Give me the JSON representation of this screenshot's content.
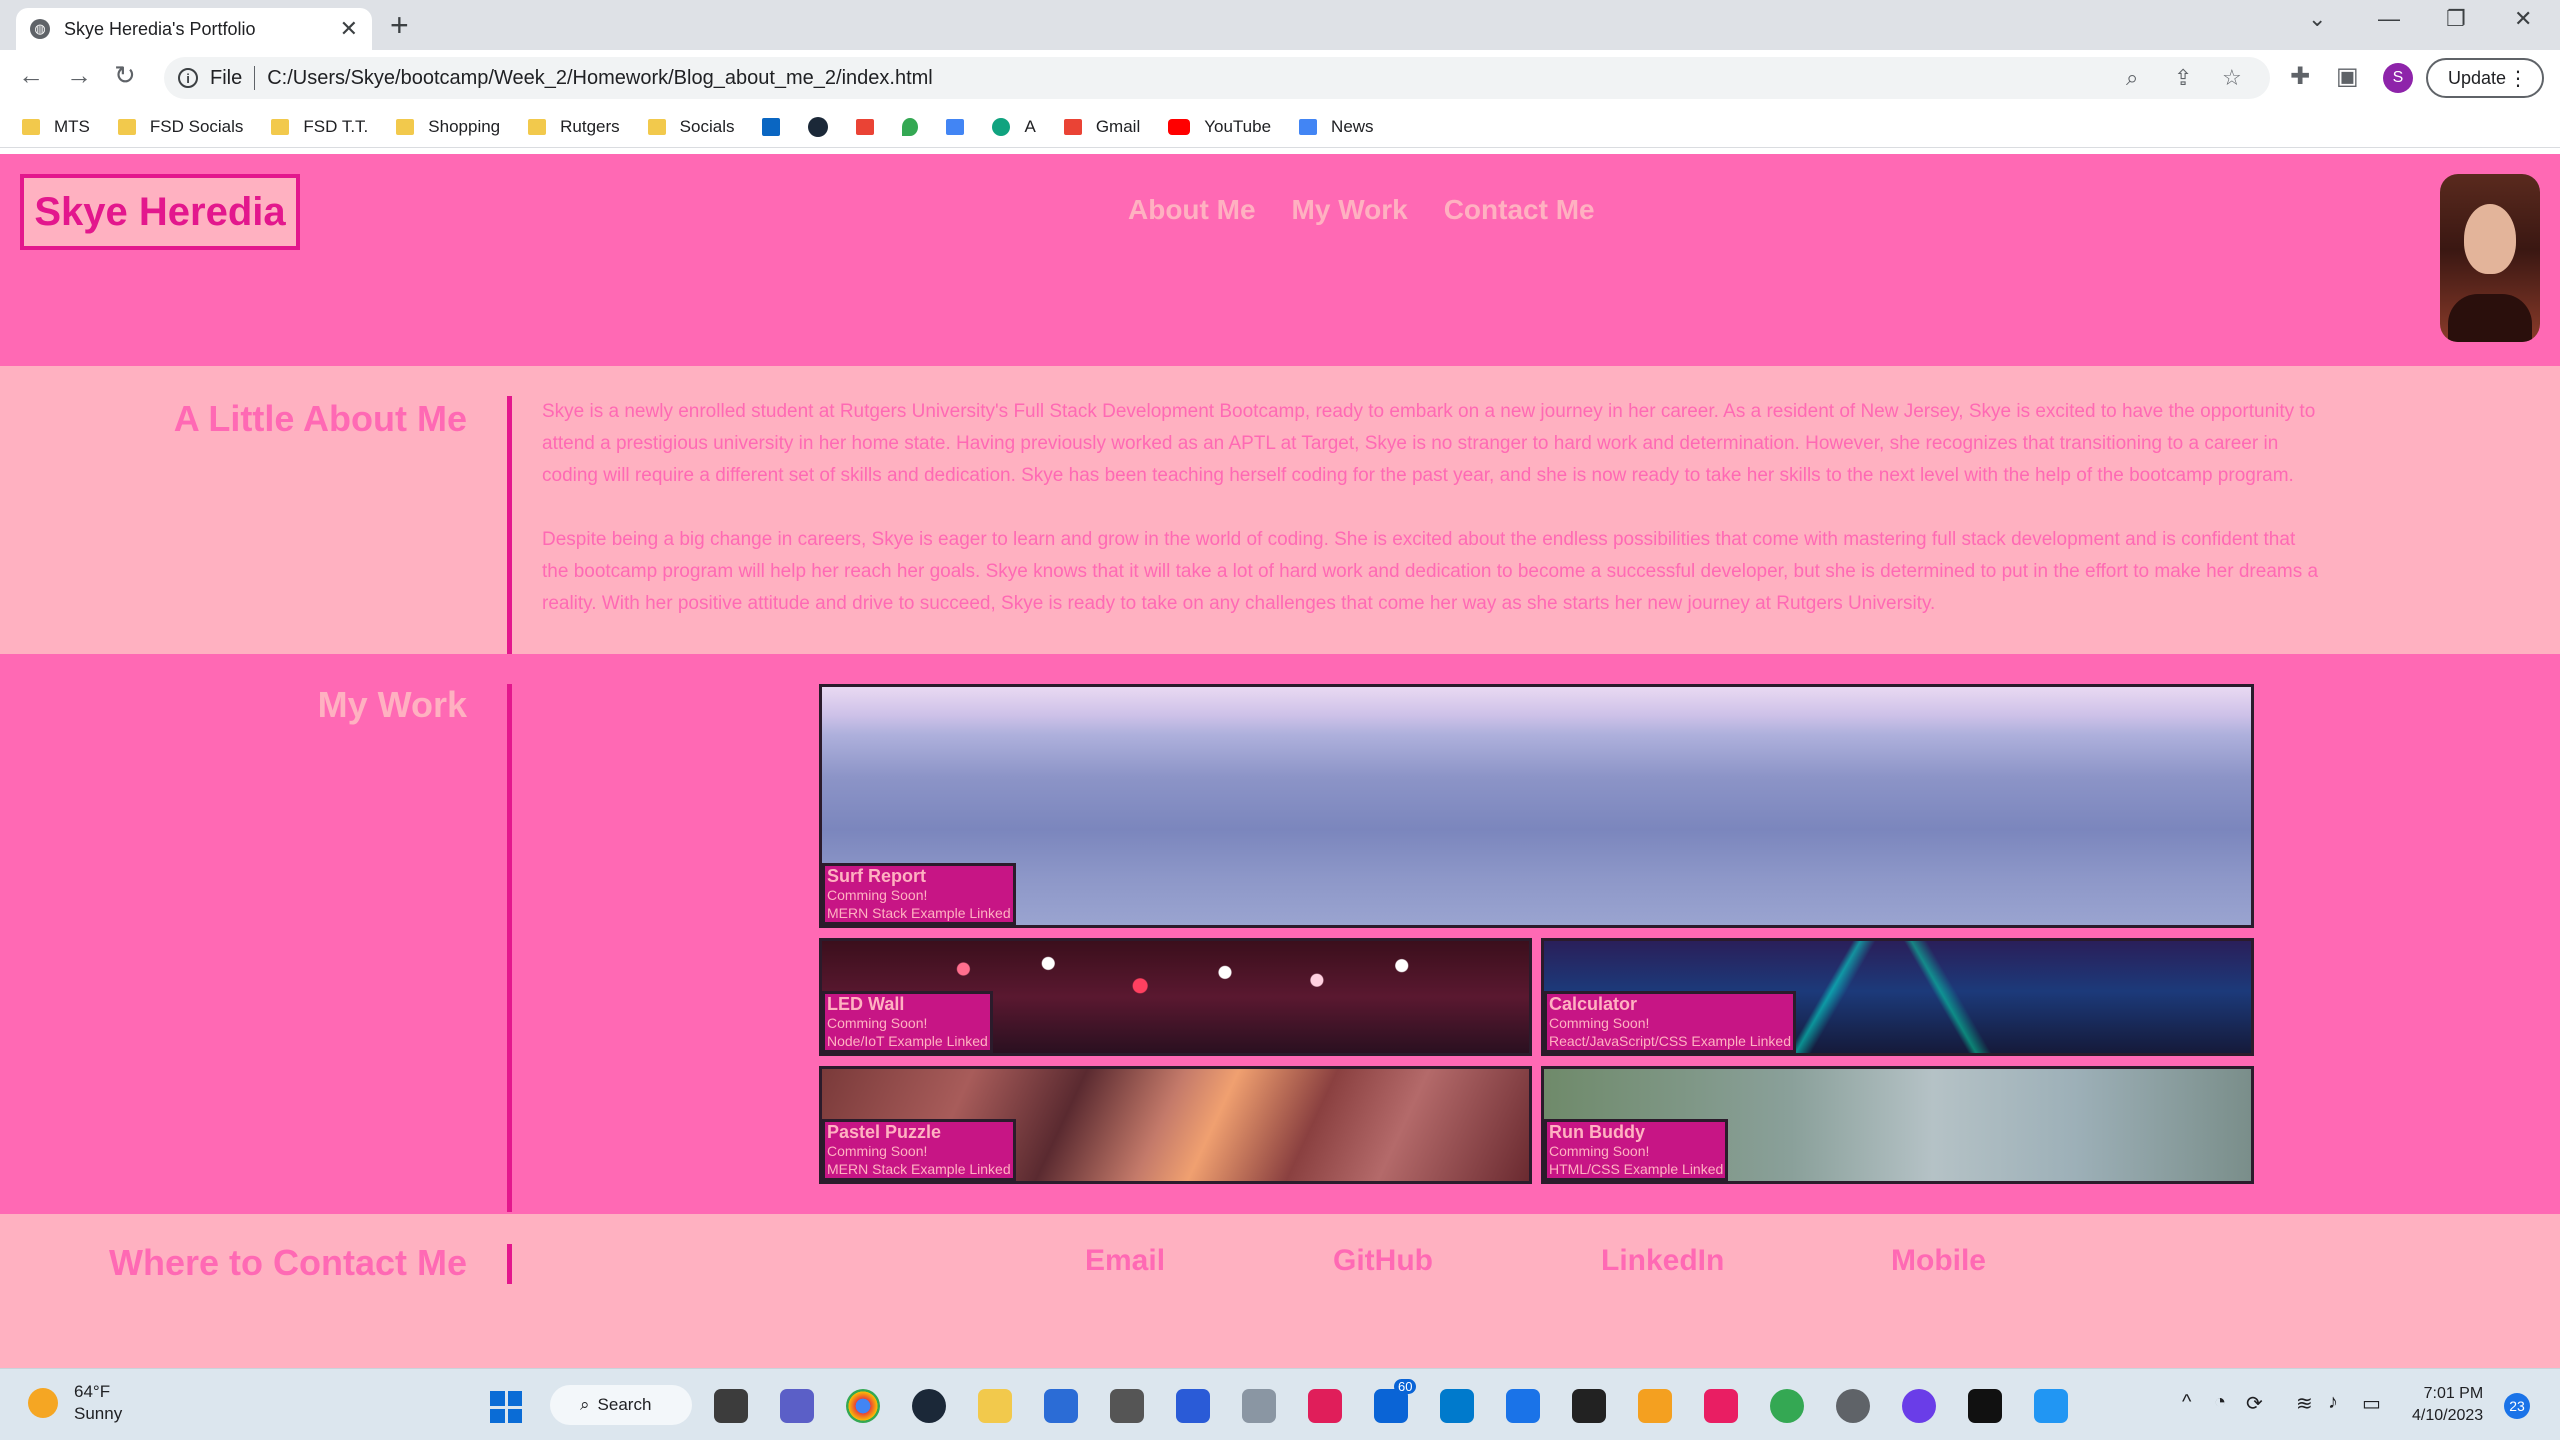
{
  "browser": {
    "tab_title": "Skye Heredia's Portfolio",
    "new_tab": "+",
    "scheme": "File",
    "url": "C:/Users/Skye/bootcamp/Week_2/Homework/Blog_about_me_2/index.html",
    "profile_initial": "S",
    "update_label": "Update",
    "bookmarks": [
      "MTS",
      "FSD Socials",
      "FSD T.T.",
      "Shopping",
      "Rutgers",
      "Socials",
      "A",
      "Gmail",
      "YouTube",
      "News"
    ]
  },
  "site": {
    "logo": "Skye Heredia",
    "nav": [
      "About Me",
      "My Work",
      "Contact Me"
    ],
    "about": {
      "title": "A Little About Me",
      "paragraphs": [
        "Skye is a newly enrolled student at Rutgers University's Full Stack Development Bootcamp, ready to embark on a new journey in her career. As a resident of New Jersey, Skye is excited to have the opportunity to attend a prestigious university in her home state. Having previously worked as an APTL at Target, Skye is no stranger to hard work and determination. However, she recognizes that transitioning to a career in coding will require a different set of skills and dedication. Skye has been teaching herself coding for the past year, and she is now ready to take her skills to the next level with the help of the bootcamp program.",
        "Despite being a big change in careers, Skye is eager to learn and grow in the world of coding. She is excited about the endless possibilities that come with mastering full stack development and is confident that the bootcamp program will help her reach her goals. Skye knows that it will take a lot of hard work and dedication to become a successful developer, but she is determined to put in the effort to make her dreams a reality. With her positive attitude and drive to succeed, Skye is ready to take on any challenges that come her way as she starts her new journey at Rutgers University."
      ]
    },
    "work": {
      "title": "My Work",
      "projects": [
        {
          "title": "Surf Report",
          "status": "Comming Soon!",
          "stack": "MERN Stack Example Linked"
        },
        {
          "title": "LED Wall",
          "status": "Comming Soon!",
          "stack": "Node/IoT Example Linked"
        },
        {
          "title": "Calculator",
          "status": "Comming Soon!",
          "stack": "React/JavaScript/CSS Example Linked"
        },
        {
          "title": "Pastel Puzzle",
          "status": "Comming Soon!",
          "stack": "MERN Stack Example Linked"
        },
        {
          "title": "Run Buddy",
          "status": "Comming Soon!",
          "stack": "HTML/CSS Example Linked"
        }
      ]
    },
    "contact": {
      "title": "Where to Contact Me",
      "links": [
        "Email",
        "GitHub",
        "LinkedIn",
        "Mobile"
      ]
    }
  },
  "taskbar": {
    "temperature": "64°F",
    "condition": "Sunny",
    "search_label": "Search",
    "mail_badge": "60",
    "time": "7:01 PM",
    "date": "4/10/2023",
    "notification_count": "23"
  },
  "colors": {
    "hot_pink": "#ff69b4",
    "light_pink": "#ffb1c1",
    "deep_pink": "#e3178d",
    "label_bg": "#c71585"
  }
}
